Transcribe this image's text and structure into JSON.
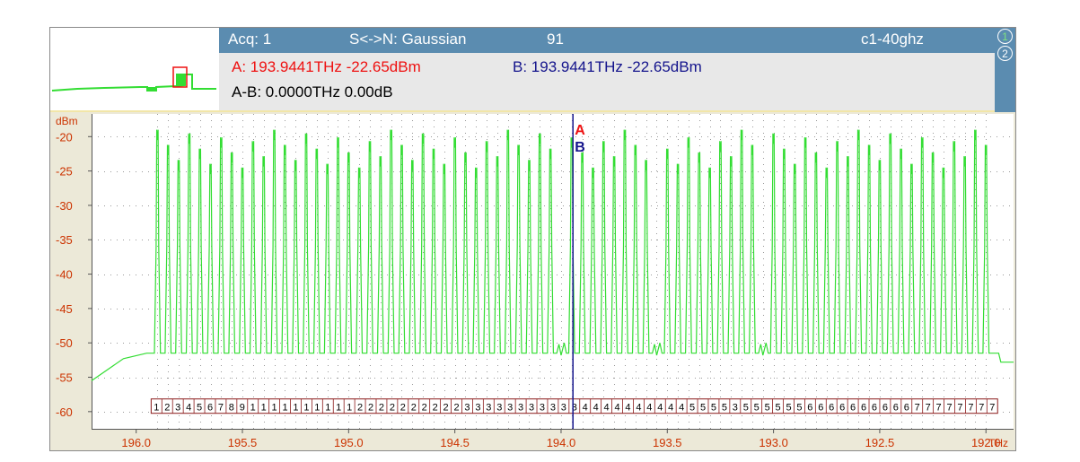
{
  "header": {
    "acq": "Acq: 1",
    "sn": "S<->N: Gaussian",
    "count": "91",
    "config": "c1-40ghz"
  },
  "markers": {
    "a": "A: 193.9441THz -22.65dBm",
    "b": "B: 193.9441THz -22.65dBm",
    "diff": "A-B: 0.0000THz  0.00dB"
  },
  "trace_tabs": [
    "1",
    "2"
  ],
  "cursor_labels": {
    "a": "A",
    "b": "B"
  },
  "colors": {
    "trace": "#33dd33",
    "marker_a": "#ee1111",
    "marker_b": "#14148c",
    "axis_labels": "#cc3300",
    "header_bg": "#5b8cb0",
    "channel_box": "#8b1a1a"
  },
  "chart_data": {
    "type": "line",
    "ylabel": "dBm",
    "xlabel": "THz",
    "x_reversed": true,
    "xlim": [
      196.21,
      191.87
    ],
    "ylim": [
      -62.5,
      -16.7
    ],
    "x_ticks": [
      196.0,
      195.5,
      195.0,
      194.5,
      194.0,
      193.5,
      193.0,
      192.5,
      192.0
    ],
    "x_tick_labels": [
      "196.0",
      "195.5",
      "195.0",
      "194.5",
      "194.0",
      "193.5",
      "193.0",
      "192.5",
      "192.0"
    ],
    "y_ticks": [
      -20,
      -25,
      -30,
      -35,
      -40,
      -45,
      -50,
      -55,
      -60
    ],
    "y_tick_labels": [
      "-20",
      "-25",
      "-30",
      "-35",
      "-40",
      "-45",
      "-50",
      "-55",
      "-60"
    ],
    "grid": "dotted",
    "channel_grid": {
      "start_thz": 195.9,
      "end_thz": 192.0,
      "spacing_thz": 0.05,
      "count": 79
    },
    "noise_floor_dbm": -51.5,
    "edge_floor_dbm": [
      -55.5,
      -52.8
    ],
    "peak_levels_dbm": [
      -20.5,
      -26.0
    ],
    "missing_channels_thz": [
      194.0,
      193.55,
      193.05
    ],
    "marker_a_thz": 193.9441,
    "marker_b_thz": 193.9441,
    "channel_labels": [
      "1",
      "2",
      "3",
      "4",
      "5",
      "6",
      "7",
      "8",
      "9",
      "1",
      "1",
      "1",
      "1",
      "1",
      "1",
      "1",
      "1",
      "1",
      "1",
      "2",
      "2",
      "2",
      "2",
      "2",
      "2",
      "2",
      "2",
      "2",
      "2",
      "3",
      "3",
      "3",
      "3",
      "3",
      "3",
      "3",
      "3",
      "3",
      "3",
      "3",
      "4",
      "4",
      "4",
      "4",
      "4",
      "4",
      "4",
      "4",
      "4",
      "4",
      "5",
      "5",
      "5",
      "5",
      "3",
      "5",
      "5",
      "5",
      "5",
      "5",
      "5",
      "6",
      "6",
      "6",
      "6",
      "6",
      "6",
      "6",
      "6",
      "6",
      "6",
      "7",
      "7",
      "7",
      "7",
      "7",
      "7",
      "7",
      "7"
    ]
  }
}
